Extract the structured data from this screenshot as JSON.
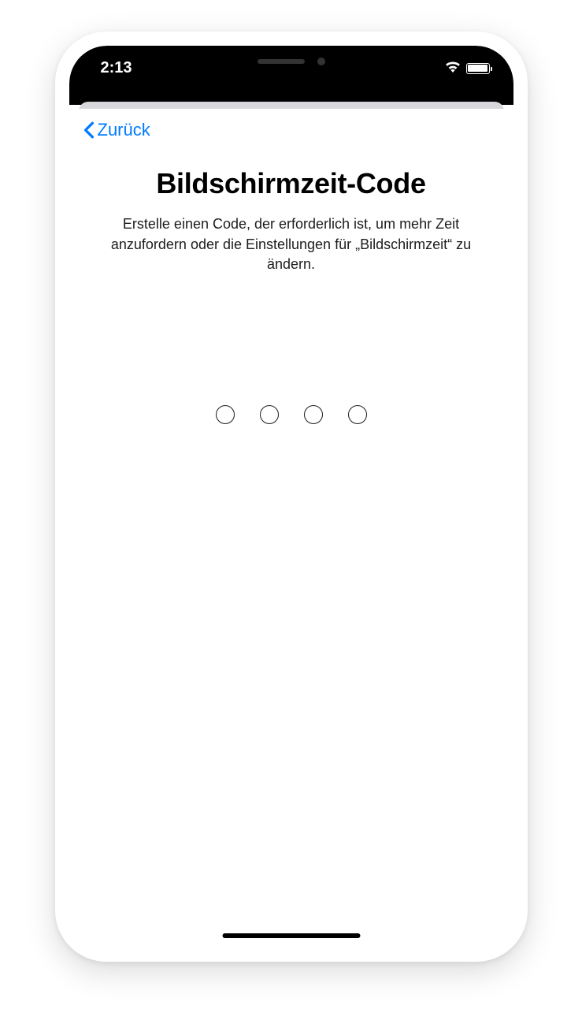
{
  "status_bar": {
    "time": "2:13"
  },
  "nav": {
    "back_label": "Zurück"
  },
  "main": {
    "title": "Bildschirmzeit-Code",
    "description": "Erstelle einen Code, der erforderlich ist, um mehr Zeit anzufordern oder die Einstellungen für „Bildschirmzeit“ zu ändern."
  },
  "passcode": {
    "length": 4,
    "entered": 0
  },
  "colors": {
    "accent": "#007AFF"
  }
}
